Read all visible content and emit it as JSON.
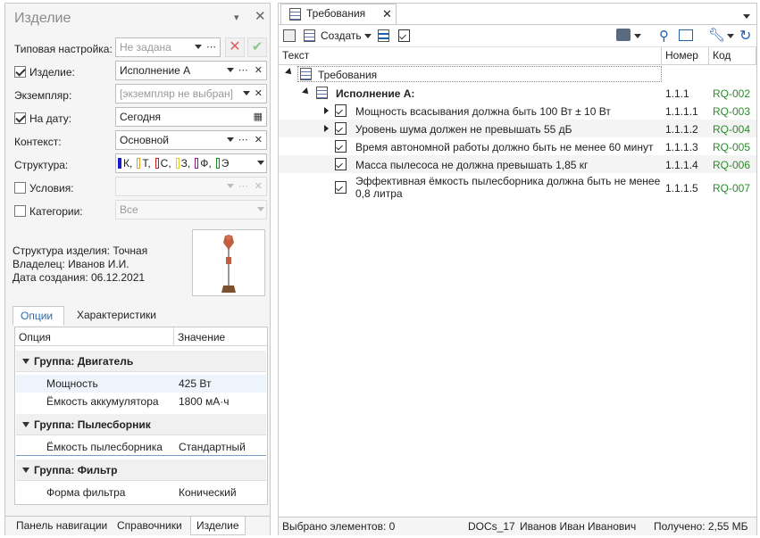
{
  "left_panel": {
    "title": "Изделие",
    "fields": [
      {
        "label": "Типовая настройка:",
        "value": "Не задана",
        "checkbox": null
      },
      {
        "label": "Изделие:",
        "value": "Исполнение А",
        "checkbox": true
      },
      {
        "label": "Экземпляр:",
        "value": "[экземпляр не выбран]",
        "checkbox": null
      },
      {
        "label": "На дату:",
        "value": "Сегодня",
        "checkbox": true
      },
      {
        "label": "Контекст:",
        "value": "Основной",
        "checkbox": null
      },
      {
        "label": "Структура:",
        "value": "",
        "checkbox": null
      },
      {
        "label": "Условия:",
        "value": "",
        "checkbox": false
      },
      {
        "label": "Категории:",
        "value": "Все",
        "checkbox": false
      }
    ],
    "structure_tags": [
      {
        "letter": "К,",
        "color": "#1a1acc"
      },
      {
        "letter": "Т,",
        "color": "#e0a020"
      },
      {
        "letter": "С,",
        "color": "#cc1a1a"
      },
      {
        "letter": "З,",
        "color": "#e0d020"
      },
      {
        "letter": "Ф,",
        "color": "#8a1a8a"
      },
      {
        "letter": "Э",
        "color": "#1a8a1a"
      }
    ],
    "info": {
      "structure": "Структура изделия:  Точная",
      "owner": "Владелец:  Иванов И.И.",
      "created": "Дата создания:  06.12.2021"
    },
    "tabs": [
      "Опции",
      "Характеристики"
    ],
    "grid": {
      "col_option": "Опция",
      "col_value": "Значение",
      "groups": [
        {
          "name": "Группа: Двигатель",
          "rows": [
            {
              "option": "Мощность",
              "value": "425 Вт"
            },
            {
              "option": "Ёмкость аккумулятора",
              "value": "1800 мА·ч"
            }
          ]
        },
        {
          "name": "Группа: Пылесборник",
          "rows": [
            {
              "option": "Ёмкость пылесборника",
              "value": "Стандартный"
            }
          ]
        },
        {
          "name": "Группа: Фильтр",
          "rows": [
            {
              "option": "Форма фильтра",
              "value": "Конический"
            }
          ]
        }
      ]
    },
    "bottom_tabs": [
      "Панель навигации",
      "Справочники",
      "Изделие"
    ]
  },
  "right_panel": {
    "tab_title": "Требования",
    "toolbar": {
      "create_label": "Создать"
    },
    "columns": {
      "text": "Текст",
      "number": "Номер",
      "code": "Код"
    },
    "root": "Требования",
    "group": {
      "text": "Исполнение А:",
      "number": "1.1.1",
      "code": "RQ-002"
    },
    "requirements": [
      {
        "text": "Мощность всасывания должна быть 100 Вт ± 10 Вт",
        "number": "1.1.1.1",
        "code": "RQ-003"
      },
      {
        "text": "Уровень шума должен не превышать 55 дБ",
        "number": "1.1.1.2",
        "code": "RQ-004"
      },
      {
        "text": "Время автономной работы должно быть не менее 60 минут",
        "number": "1.1.1.3",
        "code": "RQ-005"
      },
      {
        "text": "Масса пылесоса не должна превышать 1,85 кг",
        "number": "1.1.1.4",
        "code": "RQ-006"
      },
      {
        "text": "Эффективная ёмкость пылесборника должна быть не менее",
        "text2": "0,8 литра",
        "number": "1.1.1.5",
        "code": "RQ-007"
      }
    ],
    "status": {
      "selected": "Выбрано элементов: 0",
      "db": "DOCs_17",
      "user": "Иванов Иван Иванович",
      "received": "Получено: 2,55 МБ"
    }
  }
}
